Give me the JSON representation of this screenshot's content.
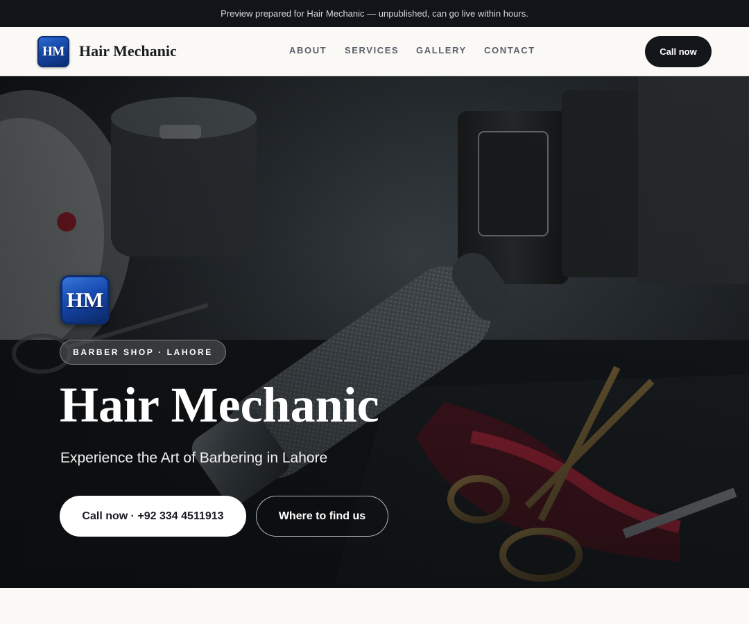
{
  "preview_bar": {
    "text": "Preview prepared for Hair Mechanic — unpublished, can go live within hours."
  },
  "header": {
    "logo_text": "HM",
    "brand_name": "Hair Mechanic",
    "nav": {
      "about": "ABOUT",
      "services": "SERVICES",
      "gallery": "GALLERY",
      "contact": "CONTACT"
    },
    "call_label": "Call now"
  },
  "hero": {
    "background": "barber-tools-photo",
    "logo_text": "HM",
    "tagline": "BARBER SHOP · LAHORE",
    "title": "Hair Mechanic",
    "subtitle": "Experience the Art of Barbering in Lahore",
    "call_button": "Call now · +92 334 4511913",
    "find_button": "Where to find us"
  },
  "colors": {
    "dark": "#14161c",
    "page_bg": "#faf9f6",
    "logo_blue": "#1546a8",
    "accent_red": "#c41e3a"
  }
}
